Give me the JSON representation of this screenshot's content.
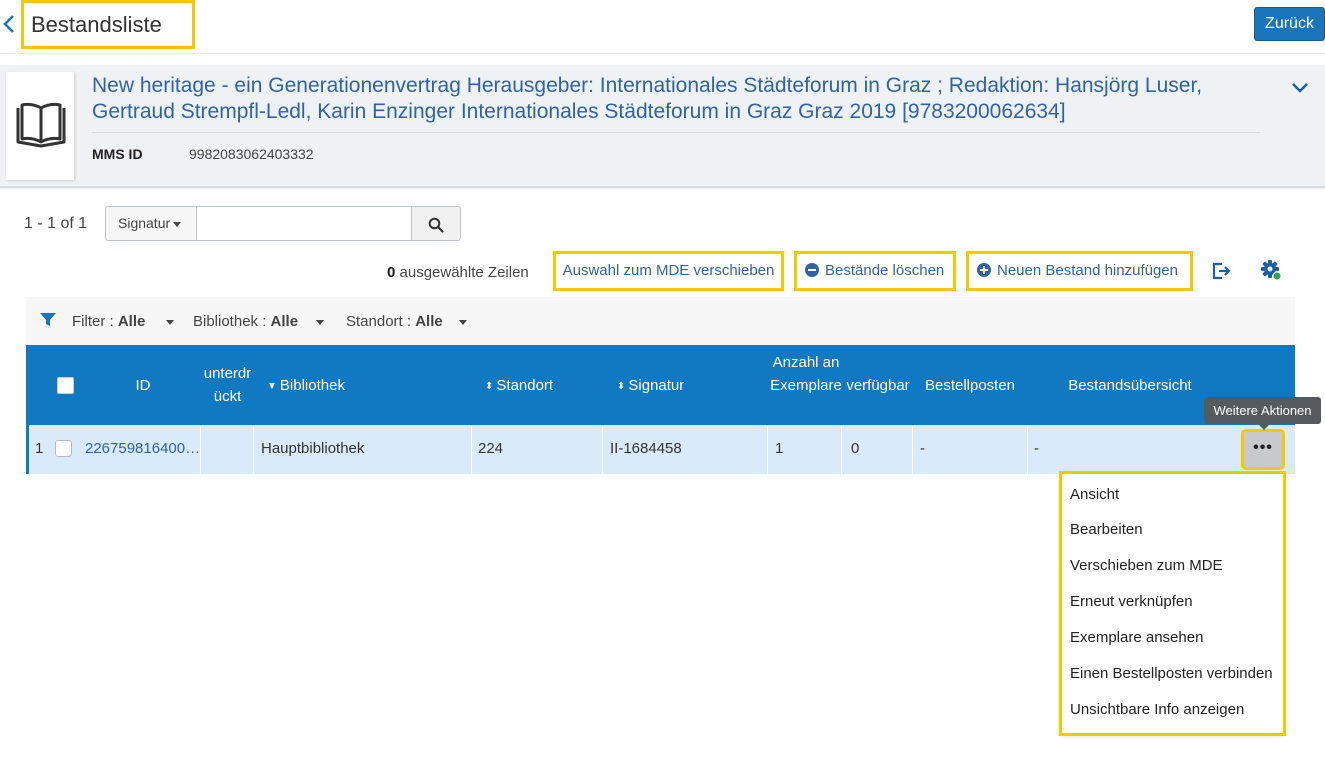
{
  "header": {
    "title": "Bestandsliste",
    "back_button": "Zurück"
  },
  "record": {
    "title": "New heritage - ein Generationenvertrag Herausgeber: Internationales Städteforum in Graz ; Redaktion: Hansjörg Luser, Gertraud Strempfl-Ledl, Karin Enzinger Internationales Städteforum in Graz Graz 2019 [9783200062634]",
    "mms_label": "MMS ID",
    "mms_value": "9982083062403332"
  },
  "search": {
    "count": "1 - 1 of 1",
    "scope": "Signatur",
    "value": ""
  },
  "actions": {
    "selected_count": "0",
    "selected_label": " ausgewählte Zeilen",
    "move": "Auswahl zum MDE verschieben",
    "delete": "Bestände löschen",
    "add": "Neuen Bestand hinzufügen"
  },
  "filters": [
    {
      "label": "Filter :",
      "value": "Alle"
    },
    {
      "label": "Bibliothek :",
      "value": "Alle"
    },
    {
      "label": "Standort :",
      "value": "Alle"
    }
  ],
  "table": {
    "columns": {
      "id": "ID",
      "suppressed": "unterdrückt",
      "library": "Bibliothek",
      "location": "Standort",
      "callnumber": "Signatur",
      "item_count": "Anzahl an Exemplare",
      "available": "verfügbar",
      "order_lines": "Bestellposten",
      "summary": "Bestandsübersicht"
    },
    "rows": [
      {
        "index": "1",
        "id": "226759816400…",
        "suppressed": "",
        "library": "Hauptbibliothek",
        "location": "224",
        "callnumber": "II-1684458",
        "item_count": "1",
        "available": "0",
        "order_lines": "-",
        "summary": "-"
      }
    ]
  },
  "tooltip": "Weitere Aktionen",
  "row_menu": [
    "Ansicht",
    "Bearbeiten",
    "Verschieben zum MDE",
    "Erneut verknüpfen",
    "Exemplare ansehen",
    "Einen Bestellposten verbinden",
    "Unsichtbare Info anzeigen"
  ]
}
